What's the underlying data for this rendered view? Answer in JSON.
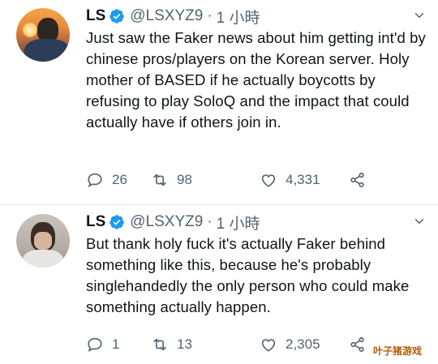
{
  "tweets": [
    {
      "name": "LS",
      "handle": "@LSXYZ9",
      "separator": "·",
      "time": "1 小時",
      "text": "Just saw the Faker news about him getting int'd by chinese pros/players on the Korean server. Holy mother of BASED if he actually boycotts by refusing to play SoloQ and the impact that could actually have if others join in.",
      "replies": "26",
      "retweets": "98",
      "likes": "4,331"
    },
    {
      "name": "LS",
      "handle": "@LSXYZ9",
      "separator": "·",
      "time": "1 小時",
      "text": "But thank holy fuck it's actually Faker behind something like this, because he's probably singlehandedly the only person who could make something actually happen.",
      "replies": "1",
      "retweets": "13",
      "likes": "2,305"
    }
  ],
  "watermark": "叶子猪游戏",
  "colors": {
    "verified": "#1d9bf0",
    "secondary_text": "#536471",
    "primary_text": "#0f1419"
  },
  "icons": [
    "verified-badge-icon",
    "more-options-icon",
    "reply-icon",
    "retweet-icon",
    "like-icon",
    "share-icon"
  ]
}
